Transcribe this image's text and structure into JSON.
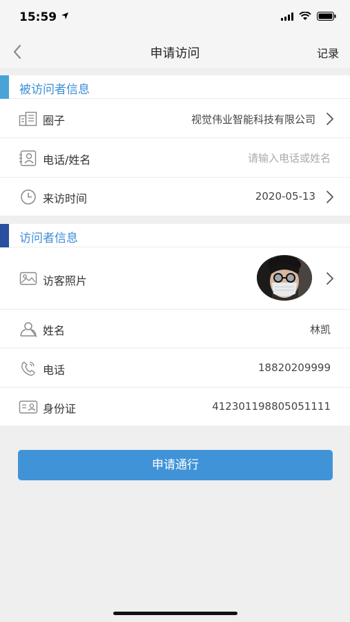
{
  "status": {
    "time": "15:59"
  },
  "nav": {
    "title": "申请访问",
    "record": "记录"
  },
  "host_section": {
    "title": "被访问者信息",
    "accent": "#4aa3d6",
    "rows": [
      {
        "label": "圈子",
        "value": "视觉伟业智能科技有限公司",
        "icon": "building-icon"
      },
      {
        "label": "电话/姓名",
        "placeholder": "请输入电话或姓名",
        "icon": "contact-card-icon"
      },
      {
        "label": "来访时间",
        "value": "2020-05-13",
        "icon": "clock-icon"
      }
    ]
  },
  "visitor_section": {
    "title": "访问者信息",
    "accent": "#2a4f9e",
    "rows": [
      {
        "label": "访客照片",
        "icon": "photo-icon"
      },
      {
        "label": "姓名",
        "value": "林凯",
        "icon": "person-icon"
      },
      {
        "label": "电话",
        "value": "18820209999",
        "icon": "phone-icon"
      },
      {
        "label": "身份证",
        "value": "412301198805051111",
        "icon": "id-card-icon"
      }
    ]
  },
  "submit_label": "申请通行",
  "colors": {
    "primary": "#4193d8",
    "link_text": "#3b8ed6"
  }
}
